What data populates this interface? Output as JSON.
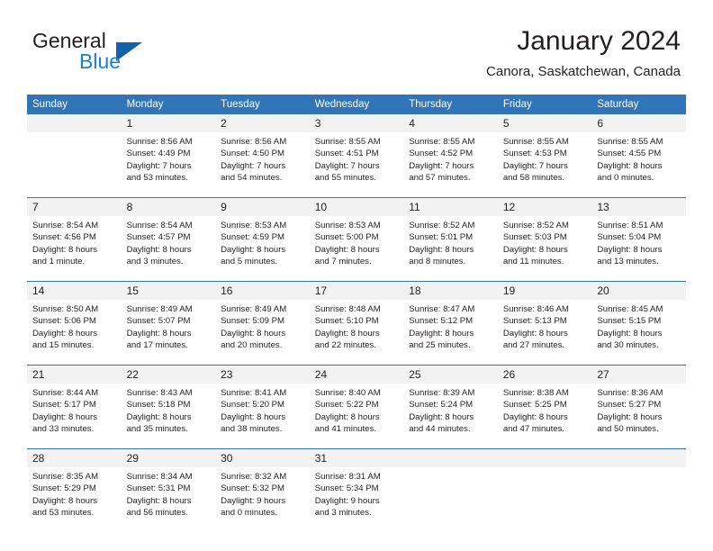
{
  "brand": {
    "name_part1": "General",
    "name_part2": "Blue",
    "triangle_color": "#1463a8",
    "blue_text_color": "#1a7fd4"
  },
  "header": {
    "title": "January 2024",
    "subtitle": "Canora, Saskatchewan, Canada",
    "accent_color": "#3274b8",
    "daynum_band_color": "#f2f2f2"
  },
  "weekday_headers": [
    "Sunday",
    "Monday",
    "Tuesday",
    "Wednesday",
    "Thursday",
    "Friday",
    "Saturday"
  ],
  "weeks": [
    {
      "days": [
        {
          "num": "",
          "lines": []
        },
        {
          "num": "1",
          "lines": [
            "Sunrise: 8:56 AM",
            "Sunset: 4:49 PM",
            "Daylight: 7 hours",
            "and 53 minutes."
          ]
        },
        {
          "num": "2",
          "lines": [
            "Sunrise: 8:56 AM",
            "Sunset: 4:50 PM",
            "Daylight: 7 hours",
            "and 54 minutes."
          ]
        },
        {
          "num": "3",
          "lines": [
            "Sunrise: 8:55 AM",
            "Sunset: 4:51 PM",
            "Daylight: 7 hours",
            "and 55 minutes."
          ]
        },
        {
          "num": "4",
          "lines": [
            "Sunrise: 8:55 AM",
            "Sunset: 4:52 PM",
            "Daylight: 7 hours",
            "and 57 minutes."
          ]
        },
        {
          "num": "5",
          "lines": [
            "Sunrise: 8:55 AM",
            "Sunset: 4:53 PM",
            "Daylight: 7 hours",
            "and 58 minutes."
          ]
        },
        {
          "num": "6",
          "lines": [
            "Sunrise: 8:55 AM",
            "Sunset: 4:55 PM",
            "Daylight: 8 hours",
            "and 0 minutes."
          ]
        }
      ]
    },
    {
      "days": [
        {
          "num": "7",
          "lines": [
            "Sunrise: 8:54 AM",
            "Sunset: 4:56 PM",
            "Daylight: 8 hours",
            "and 1 minute."
          ]
        },
        {
          "num": "8",
          "lines": [
            "Sunrise: 8:54 AM",
            "Sunset: 4:57 PM",
            "Daylight: 8 hours",
            "and 3 minutes."
          ]
        },
        {
          "num": "9",
          "lines": [
            "Sunrise: 8:53 AM",
            "Sunset: 4:59 PM",
            "Daylight: 8 hours",
            "and 5 minutes."
          ]
        },
        {
          "num": "10",
          "lines": [
            "Sunrise: 8:53 AM",
            "Sunset: 5:00 PM",
            "Daylight: 8 hours",
            "and 7 minutes."
          ]
        },
        {
          "num": "11",
          "lines": [
            "Sunrise: 8:52 AM",
            "Sunset: 5:01 PM",
            "Daylight: 8 hours",
            "and 8 minutes."
          ]
        },
        {
          "num": "12",
          "lines": [
            "Sunrise: 8:52 AM",
            "Sunset: 5:03 PM",
            "Daylight: 8 hours",
            "and 11 minutes."
          ]
        },
        {
          "num": "13",
          "lines": [
            "Sunrise: 8:51 AM",
            "Sunset: 5:04 PM",
            "Daylight: 8 hours",
            "and 13 minutes."
          ]
        }
      ]
    },
    {
      "days": [
        {
          "num": "14",
          "lines": [
            "Sunrise: 8:50 AM",
            "Sunset: 5:06 PM",
            "Daylight: 8 hours",
            "and 15 minutes."
          ]
        },
        {
          "num": "15",
          "lines": [
            "Sunrise: 8:49 AM",
            "Sunset: 5:07 PM",
            "Daylight: 8 hours",
            "and 17 minutes."
          ]
        },
        {
          "num": "16",
          "lines": [
            "Sunrise: 8:49 AM",
            "Sunset: 5:09 PM",
            "Daylight: 8 hours",
            "and 20 minutes."
          ]
        },
        {
          "num": "17",
          "lines": [
            "Sunrise: 8:48 AM",
            "Sunset: 5:10 PM",
            "Daylight: 8 hours",
            "and 22 minutes."
          ]
        },
        {
          "num": "18",
          "lines": [
            "Sunrise: 8:47 AM",
            "Sunset: 5:12 PM",
            "Daylight: 8 hours",
            "and 25 minutes."
          ]
        },
        {
          "num": "19",
          "lines": [
            "Sunrise: 8:46 AM",
            "Sunset: 5:13 PM",
            "Daylight: 8 hours",
            "and 27 minutes."
          ]
        },
        {
          "num": "20",
          "lines": [
            "Sunrise: 8:45 AM",
            "Sunset: 5:15 PM",
            "Daylight: 8 hours",
            "and 30 minutes."
          ]
        }
      ]
    },
    {
      "days": [
        {
          "num": "21",
          "lines": [
            "Sunrise: 8:44 AM",
            "Sunset: 5:17 PM",
            "Daylight: 8 hours",
            "and 33 minutes."
          ]
        },
        {
          "num": "22",
          "lines": [
            "Sunrise: 8:43 AM",
            "Sunset: 5:18 PM",
            "Daylight: 8 hours",
            "and 35 minutes."
          ]
        },
        {
          "num": "23",
          "lines": [
            "Sunrise: 8:41 AM",
            "Sunset: 5:20 PM",
            "Daylight: 8 hours",
            "and 38 minutes."
          ]
        },
        {
          "num": "24",
          "lines": [
            "Sunrise: 8:40 AM",
            "Sunset: 5:22 PM",
            "Daylight: 8 hours",
            "and 41 minutes."
          ]
        },
        {
          "num": "25",
          "lines": [
            "Sunrise: 8:39 AM",
            "Sunset: 5:24 PM",
            "Daylight: 8 hours",
            "and 44 minutes."
          ]
        },
        {
          "num": "26",
          "lines": [
            "Sunrise: 8:38 AM",
            "Sunset: 5:25 PM",
            "Daylight: 8 hours",
            "and 47 minutes."
          ]
        },
        {
          "num": "27",
          "lines": [
            "Sunrise: 8:36 AM",
            "Sunset: 5:27 PM",
            "Daylight: 8 hours",
            "and 50 minutes."
          ]
        }
      ]
    },
    {
      "days": [
        {
          "num": "28",
          "lines": [
            "Sunrise: 8:35 AM",
            "Sunset: 5:29 PM",
            "Daylight: 8 hours",
            "and 53 minutes."
          ]
        },
        {
          "num": "29",
          "lines": [
            "Sunrise: 8:34 AM",
            "Sunset: 5:31 PM",
            "Daylight: 8 hours",
            "and 56 minutes."
          ]
        },
        {
          "num": "30",
          "lines": [
            "Sunrise: 8:32 AM",
            "Sunset: 5:32 PM",
            "Daylight: 9 hours",
            "and 0 minutes."
          ]
        },
        {
          "num": "31",
          "lines": [
            "Sunrise: 8:31 AM",
            "Sunset: 5:34 PM",
            "Daylight: 9 hours",
            "and 3 minutes."
          ]
        },
        {
          "num": "",
          "lines": []
        },
        {
          "num": "",
          "lines": []
        },
        {
          "num": "",
          "lines": []
        }
      ]
    }
  ]
}
